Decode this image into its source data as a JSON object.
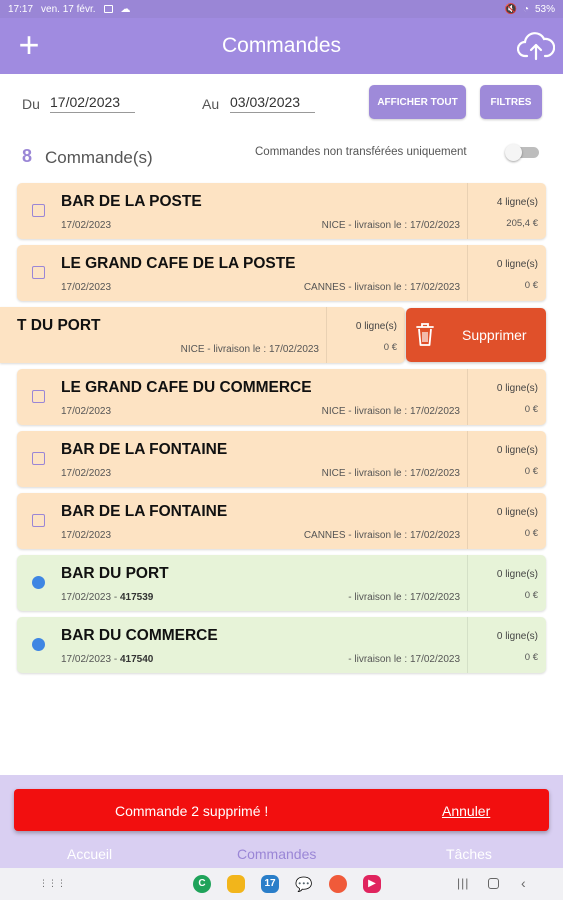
{
  "status_bar": {
    "time": "17:17",
    "date": "ven. 17 févr.",
    "battery": "53%"
  },
  "app_bar": {
    "title": "Commandes",
    "add_icon": "plus-icon",
    "sync_icon": "cloud-upload-icon"
  },
  "date_filter": {
    "from_label": "Du",
    "from_value": "17/02/2023",
    "to_label": "Au",
    "to_value": "03/03/2023",
    "show_all_label": "AFFICHER TOUT",
    "filters_label": "FILTRES"
  },
  "summary": {
    "count": "8",
    "count_label": "Commande(s)",
    "only_untransferred_label": "Commandes non transférées uniquement",
    "only_untransferred_on": false
  },
  "orders": [
    {
      "name": "BAR DE LA POSTE",
      "date": "17/02/2023",
      "number": "",
      "location": "NICE - livraison le : 17/02/2023",
      "lines": "4 ligne(s)",
      "amount": "205,4 €",
      "status": "pending"
    },
    {
      "name": "LE GRAND CAFE DE LA POSTE",
      "date": "17/02/2023",
      "number": "",
      "location": "CANNES - livraison le : 17/02/2023",
      "lines": "0 ligne(s)",
      "amount": "0 €",
      "status": "pending"
    },
    {
      "name": "T DU PORT",
      "date": "",
      "number": "",
      "location": "NICE - livraison le : 17/02/2023",
      "lines": "0 ligne(s)",
      "amount": "0 €",
      "status": "swiped"
    },
    {
      "name": "LE GRAND CAFE DU COMMERCE",
      "date": "17/02/2023",
      "number": "",
      "location": "NICE - livraison le : 17/02/2023",
      "lines": "0 ligne(s)",
      "amount": "0 €",
      "status": "pending"
    },
    {
      "name": "BAR DE LA FONTAINE",
      "date": "17/02/2023",
      "number": "",
      "location": "NICE - livraison le : 17/02/2023",
      "lines": "0 ligne(s)",
      "amount": "0 €",
      "status": "pending"
    },
    {
      "name": "BAR DE LA FONTAINE",
      "date": "17/02/2023",
      "number": "",
      "location": "CANNES - livraison le : 17/02/2023",
      "lines": "0 ligne(s)",
      "amount": "0 €",
      "status": "pending"
    },
    {
      "name": "BAR DU PORT",
      "date": "17/02/2023",
      "number": "417539",
      "location": "- livraison le : 17/02/2023",
      "lines": "0 ligne(s)",
      "amount": "0 €",
      "status": "transferred"
    },
    {
      "name": "BAR DU COMMERCE",
      "date": "17/02/2023",
      "number": "417540",
      "location": "- livraison le : 17/02/2023",
      "lines": "0 ligne(s)",
      "amount": "0 €",
      "status": "transferred"
    }
  ],
  "swipe_action": {
    "label": "Supprimer",
    "icon": "trash-icon",
    "color": "#e0502a"
  },
  "bottom_nav": [
    {
      "label": "Accueil",
      "active": false
    },
    {
      "label": "Commandes",
      "active": true
    },
    {
      "label": "Tâches",
      "active": false
    }
  ],
  "snackbar": {
    "message": "Commande 2 supprimé !",
    "action": "Annuler",
    "color": "#f20f0f"
  },
  "colors": {
    "accent": "#a08be0",
    "pending_card": "#fde3c3",
    "transferred_card": "#e7f3d8",
    "transferred_dot": "#3f86e3"
  }
}
